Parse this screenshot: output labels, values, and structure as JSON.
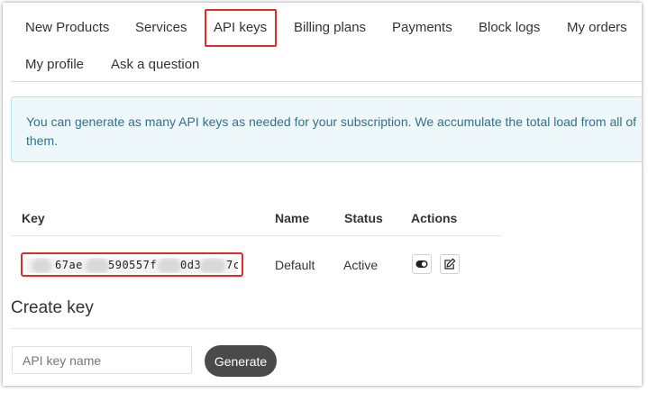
{
  "tabs": [
    {
      "label": "New Products"
    },
    {
      "label": "Services"
    },
    {
      "label": "API keys",
      "active": true
    },
    {
      "label": "Billing plans"
    },
    {
      "label": "Payments"
    },
    {
      "label": "Block logs"
    },
    {
      "label": "My orders"
    },
    {
      "label": "My profile"
    },
    {
      "label": "Ask a question"
    }
  ],
  "info": {
    "line1": "You can generate as many API keys as needed for your subscription. We accumulate the total load from all of",
    "line2": "them."
  },
  "table": {
    "headers": {
      "key": "Key",
      "name": "Name",
      "status": "Status",
      "actions": "Actions"
    },
    "rows": [
      {
        "key_segments": [
          "67ae",
          "590557f",
          "0d3",
          "7c"
        ],
        "name": "Default",
        "status": "Active",
        "actions": [
          "toggle-icon",
          "edit-icon"
        ]
      }
    ]
  },
  "create": {
    "title": "Create key",
    "input_placeholder": "API key name",
    "button_label": "Generate"
  },
  "colors": {
    "highlight": "#e02b2b",
    "info_text": "#31708f",
    "info_bg": "#eef8fa",
    "button_bg": "#4a4a4a"
  }
}
